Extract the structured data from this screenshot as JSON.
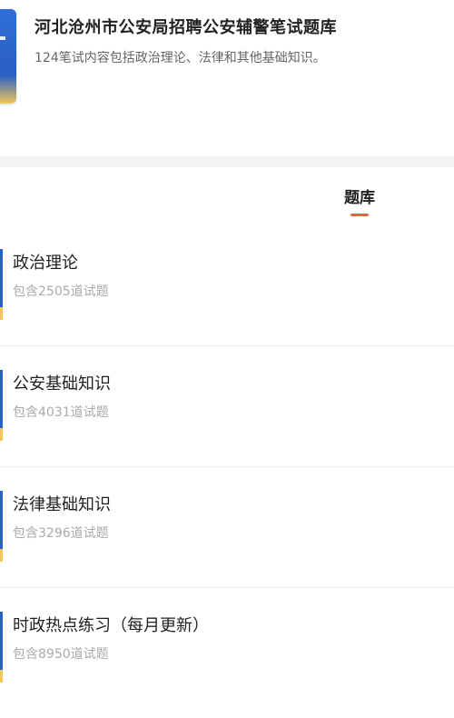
{
  "header": {
    "title": "河北沧州市公安局招聘公安辅警笔试题库",
    "subtitle": "124笔试内容包括政治理论、法律和其他基础知识。",
    "cover_icon": "book-cover-icon"
  },
  "tabs": [
    {
      "label": "题库",
      "active": true
    }
  ],
  "colors": {
    "accent": "#e8643c",
    "cover_blue": "#2a5fc4",
    "cover_yellow": "#f1c75b",
    "muted_text": "#aaaaaa"
  },
  "items": [
    {
      "title": "政治理论",
      "count": "包含2505道试题"
    },
    {
      "title": "公安基础知识",
      "count": "包含4031道试题"
    },
    {
      "title": "法律基础知识",
      "count": "包含3296道试题"
    },
    {
      "title": "时政热点练习（每月更新）",
      "count": "包含8950道试题"
    }
  ]
}
